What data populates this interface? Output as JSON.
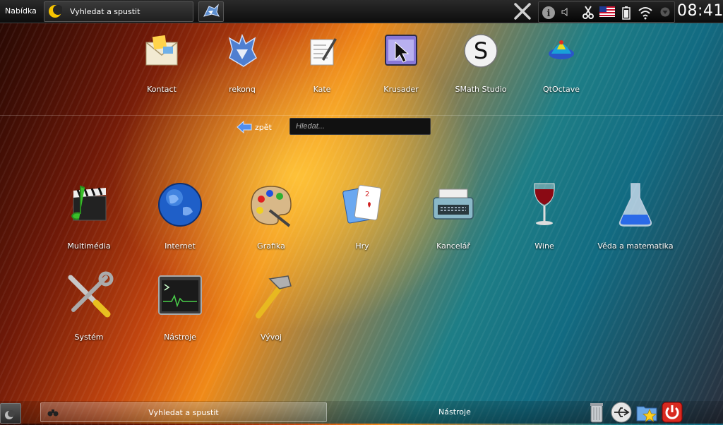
{
  "topbar": {
    "menu_label": "Nabídka",
    "launcher_text": "Vyhledat a spustit",
    "clock": "08:41"
  },
  "favorites": [
    {
      "label": "Kontact"
    },
    {
      "label": "rekonq"
    },
    {
      "label": "Kate"
    },
    {
      "label": "Krusader"
    },
    {
      "label": "SMath Studio"
    },
    {
      "label": "QtOctave"
    }
  ],
  "nav": {
    "back_label": "zpět",
    "search_placeholder": "Hledat..."
  },
  "categories": [
    {
      "label": "Multimédia"
    },
    {
      "label": "Internet"
    },
    {
      "label": "Grafika"
    },
    {
      "label": "Hry"
    },
    {
      "label": "Kancelář"
    },
    {
      "label": "Wine"
    },
    {
      "label": "Věda a matematika"
    },
    {
      "label": "Systém"
    },
    {
      "label": "Nástroje"
    },
    {
      "label": "Vývoj"
    }
  ],
  "bottombar": {
    "search_text": "Vyhledat a spustit",
    "section_label": "Nástroje"
  },
  "icons": {
    "tray": [
      "info-icon",
      "volume-icon",
      "klipper-scissors-icon",
      "us-flag-icon",
      "battery-icon",
      "wifi-icon",
      "expand-tray-icon"
    ],
    "bottom": [
      "trash-icon",
      "usb-icon",
      "favorites-folder-icon",
      "power-icon"
    ]
  }
}
